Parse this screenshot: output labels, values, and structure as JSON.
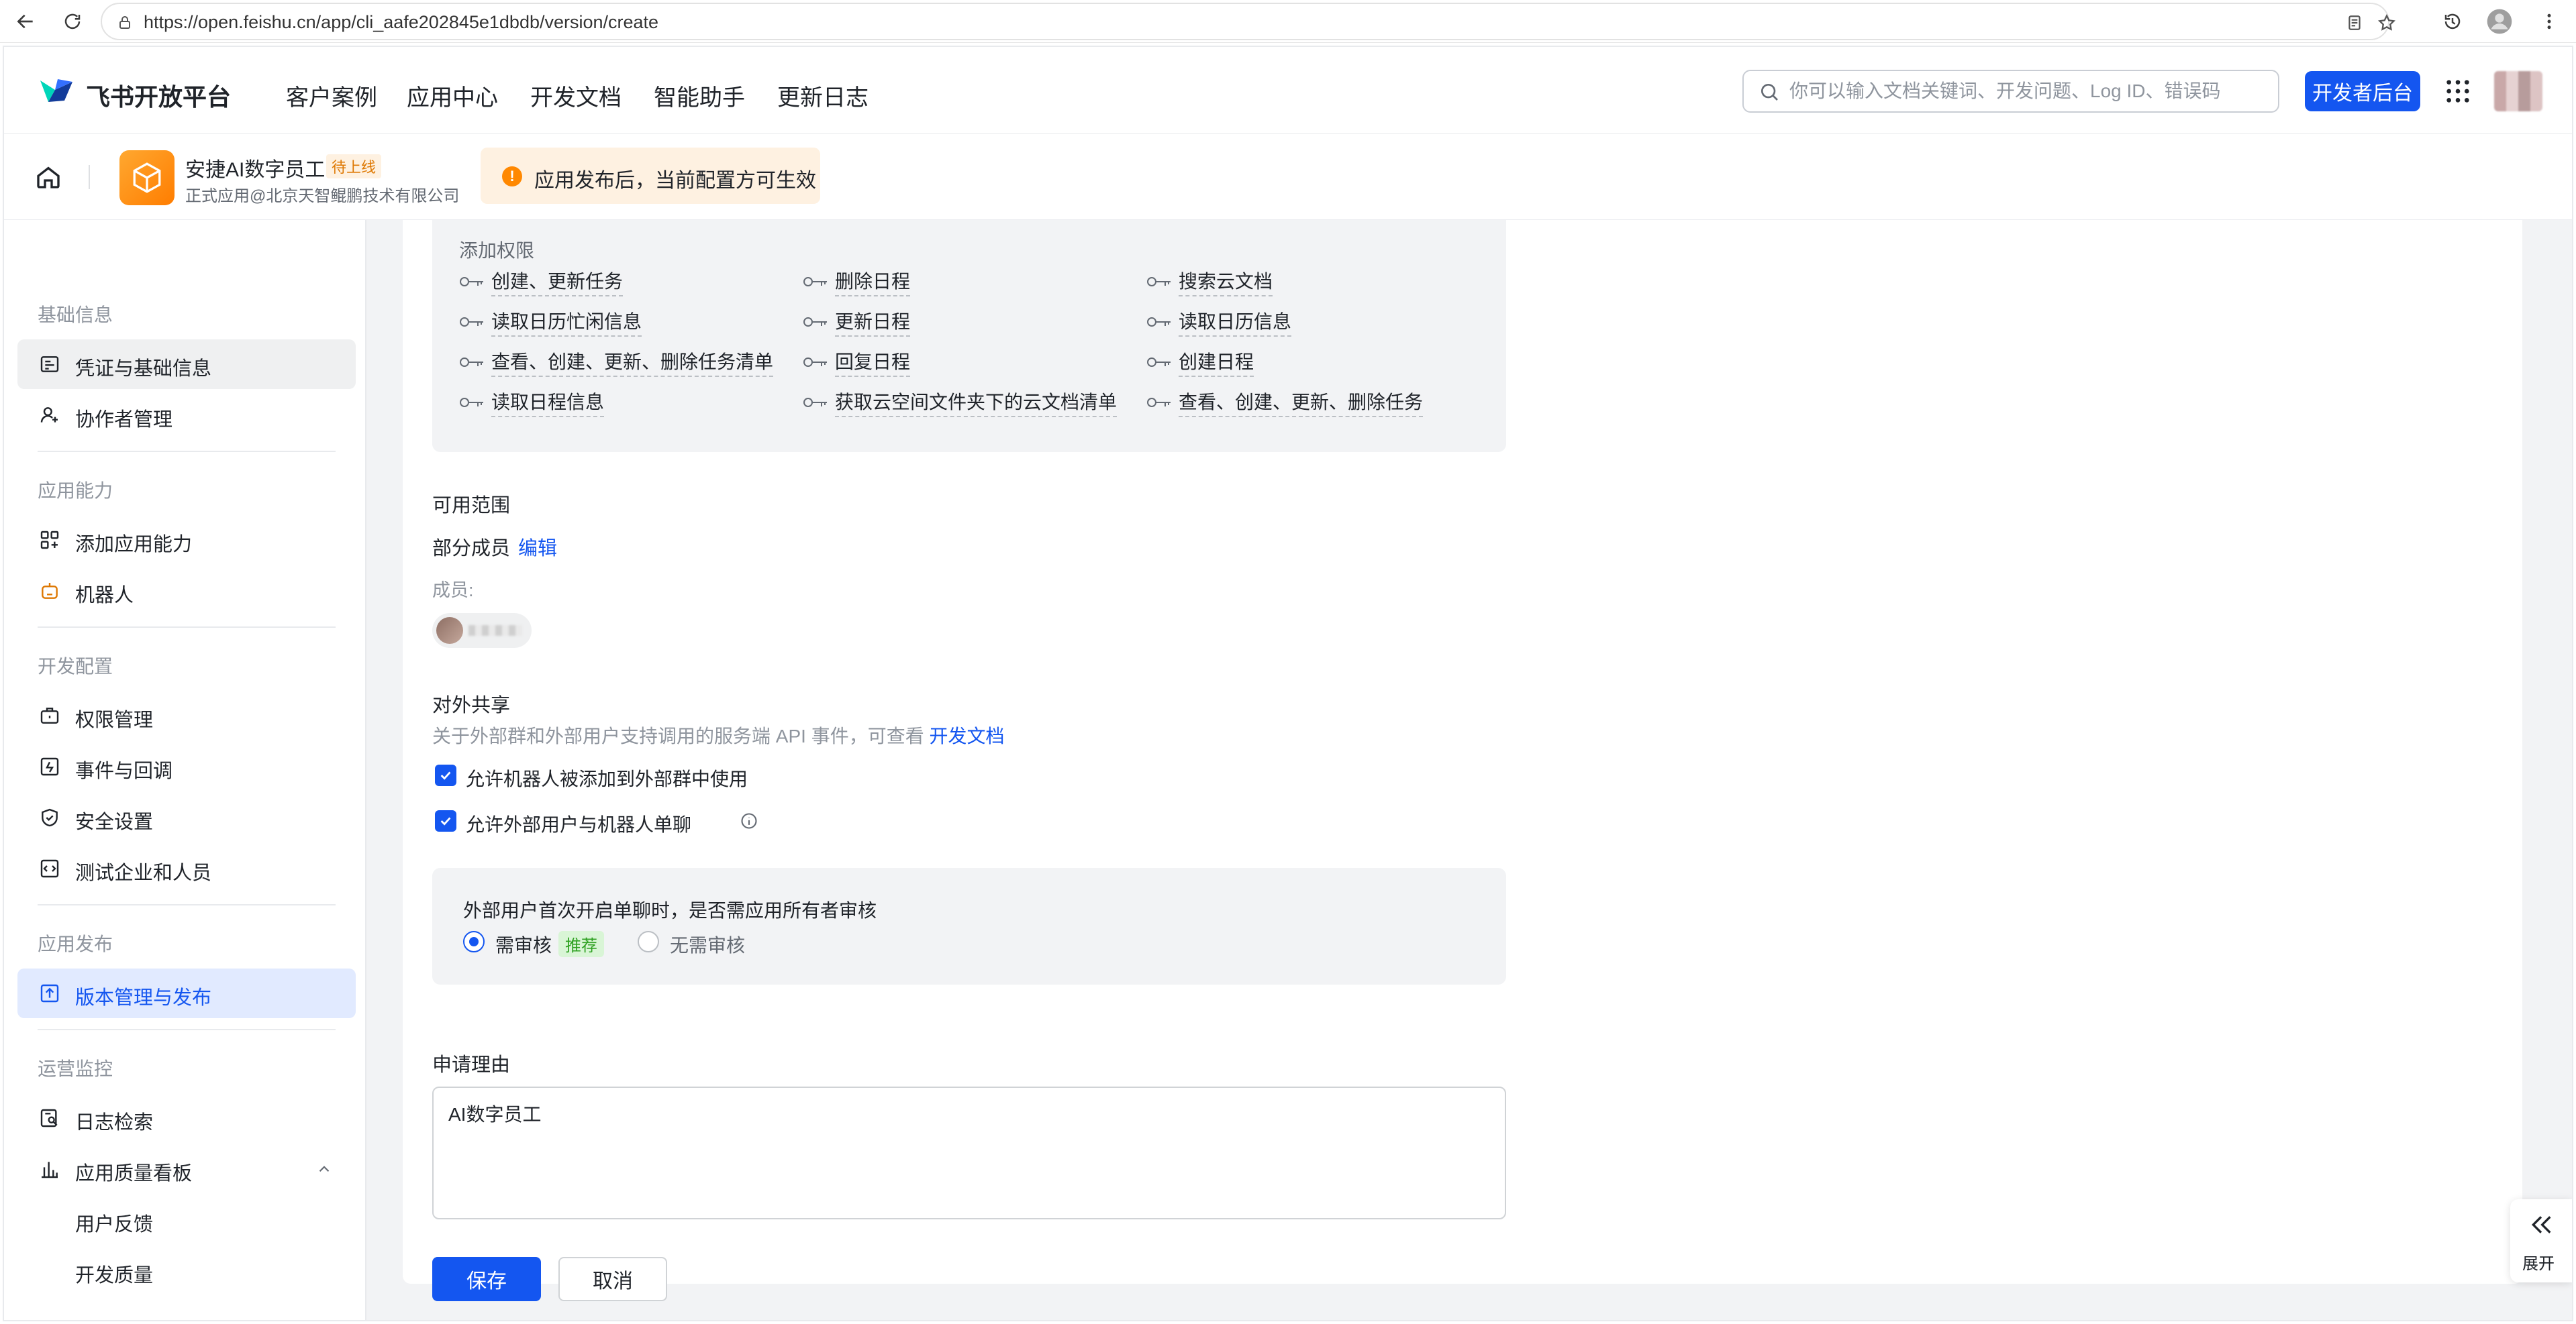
{
  "browser": {
    "url": "https://open.feishu.cn/app/cli_aafe202845e1dbdb/version/create"
  },
  "header": {
    "logo_text": "飞书开放平台",
    "nav": [
      "客户案例",
      "应用中心",
      "开发文档",
      "智能助手",
      "更新日志"
    ],
    "search_placeholder": "你可以输入文档关键词、开发问题、Log ID、错误码",
    "dev_console_label": "开发者后台"
  },
  "app": {
    "name": "安捷AI数字员工",
    "status_badge": "待上线",
    "subtitle": "正式应用@北京天智鲲鹏技术有限公司",
    "notice": "应用发布后，当前配置方可生效",
    "notice_icon": "!"
  },
  "sidebar": {
    "groups": [
      {
        "title": "基础信息",
        "items": [
          "凭证与基础信息",
          "协作者管理"
        ]
      },
      {
        "title": "应用能力",
        "items": [
          "添加应用能力",
          "机器人"
        ]
      },
      {
        "title": "开发配置",
        "items": [
          "权限管理",
          "事件与回调",
          "安全设置",
          "测试企业和人员"
        ]
      },
      {
        "title": "应用发布",
        "items": [
          "版本管理与发布"
        ]
      },
      {
        "title": "运营监控",
        "items": [
          "日志检索",
          "应用质量看板"
        ],
        "sub_items": [
          "用户反馈",
          "开发质量"
        ]
      }
    ]
  },
  "permissions": {
    "title": "添加权限",
    "items": [
      [
        "创建、更新任务",
        "删除日程",
        "搜索云文档"
      ],
      [
        "读取日历忙闲信息",
        "更新日程",
        "读取日历信息"
      ],
      [
        "查看、创建、更新、删除任务清单",
        "回复日程",
        "创建日程"
      ],
      [
        "读取日程信息",
        "获取云空间文件夹下的云文档清单",
        "查看、创建、更新、删除任务"
      ]
    ]
  },
  "scope": {
    "title": "可用范围",
    "value": "部分成员",
    "edit_label": "编辑",
    "members_label": "成员:"
  },
  "sharing": {
    "title": "对外共享",
    "desc": "关于外部群和外部用户支持调用的服务端 API 事件，可查看",
    "doc_link": "开发文档",
    "option1": "允许机器人被添加到外部群中使用",
    "option2": "允许外部用户与机器人单聊",
    "review_question": "外部用户首次开启单聊时，是否需应用所有者审核",
    "radio_need": "需审核",
    "radio_need_tag": "推荐",
    "radio_no": "无需审核"
  },
  "reason": {
    "title": "申请理由",
    "value": "AI数字员工"
  },
  "actions": {
    "save": "保存",
    "cancel": "取消",
    "expand": "展开"
  },
  "colors": {
    "primary": "#1456f0",
    "warning": "#ff8800",
    "success_tag": "#2ea121"
  }
}
